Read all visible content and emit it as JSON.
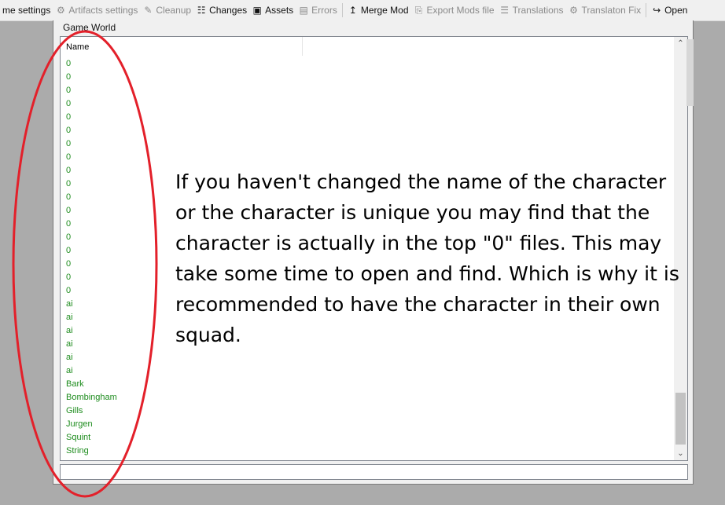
{
  "toolbar": {
    "items": [
      {
        "label": "me settings",
        "icon": "gear-icon",
        "glyph": "",
        "enabled": true
      },
      {
        "label": "Artifacts settings",
        "icon": "artifacts-settings-icon",
        "glyph": "⚙",
        "enabled": false
      },
      {
        "label": "Cleanup",
        "icon": "broom-icon",
        "glyph": "✎",
        "enabled": false
      },
      {
        "label": "Changes",
        "icon": "changes-icon",
        "glyph": "☷",
        "enabled": true
      },
      {
        "label": "Assets",
        "icon": "assets-icon",
        "glyph": "▣",
        "enabled": true
      },
      {
        "label": "Errors",
        "icon": "errors-icon",
        "glyph": "▤",
        "enabled": false
      },
      {
        "label": "Merge Mod",
        "icon": "merge-icon",
        "glyph": "↥",
        "enabled": true
      },
      {
        "label": "Export Mods file",
        "icon": "export-icon",
        "glyph": "⎘",
        "enabled": false
      },
      {
        "label": "Translations",
        "icon": "translations-icon",
        "glyph": "☰",
        "enabled": false
      },
      {
        "label": "Translaton Fix",
        "icon": "translation-fix-icon",
        "glyph": "⚙",
        "enabled": false
      },
      {
        "label": "Open",
        "icon": "open-icon",
        "glyph": "↪",
        "enabled": true
      }
    ]
  },
  "window": {
    "title": "Game World",
    "column_header": "Name",
    "rows": [
      "0",
      "0",
      "0",
      "0",
      "0",
      "0",
      "0",
      "0",
      "0",
      "0",
      "0",
      "0",
      "0",
      "0",
      "0",
      "0",
      "0",
      "0",
      "ai",
      "ai",
      "ai",
      "ai",
      "ai",
      "ai",
      "Bark",
      "Bombingham",
      "Gills",
      "Jurgen",
      "Squint",
      "String"
    ]
  },
  "annotation": {
    "text": "If you haven't changed the name of the character or the character is unique you may find that the character is actually in the top \"0\" files. This may take some time to open and find. Which is why it is recommended to have the character in their own squad."
  },
  "colors": {
    "row_text": "#1e8c1e",
    "annotation_circle": "#e3202a"
  }
}
